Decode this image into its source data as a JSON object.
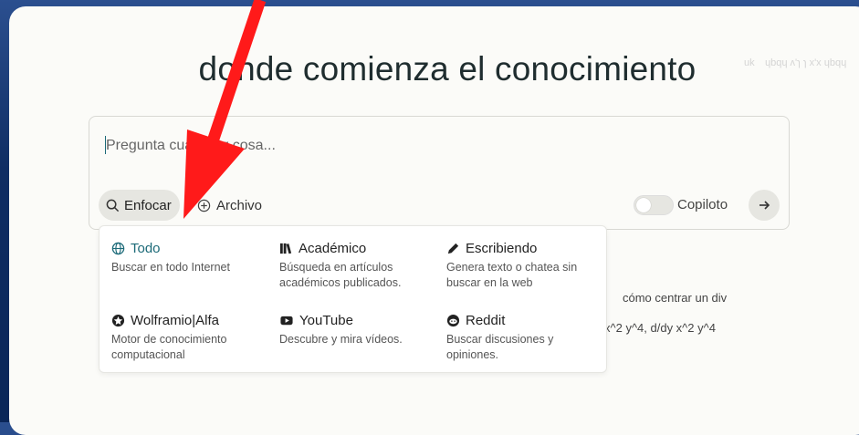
{
  "background_text": {
    "left": "uk",
    "right": "ɥbqɥ ʌ'ɿ ɿ x'x ɥbqɥ"
  },
  "headline": "donde comienza el conocimiento",
  "search": {
    "placeholder": "Pregunta cualquier cosa...",
    "value": ""
  },
  "toolbar": {
    "focus_label": "Enfocar",
    "attach_label": "Archivo",
    "copilot_label": "Copiloto",
    "copilot_on": false
  },
  "focus_menu": {
    "options": [
      {
        "icon": "globe-icon",
        "title": "Todo",
        "description": "Buscar en todo Internet",
        "active": true
      },
      {
        "icon": "books-icon",
        "title": "Académico",
        "description": "Búsqueda en artículos académicos publicados.",
        "active": false
      },
      {
        "icon": "pencil-icon",
        "title": "Escribiendo",
        "description": "Genera texto o chatea sin buscar en la web",
        "active": false
      },
      {
        "icon": "wolfram-icon",
        "title": "Wolframio|Alfa",
        "description": "Motor de conocimiento computacional",
        "active": false
      },
      {
        "icon": "youtube-icon",
        "title": "YouTube",
        "description": "Descubre y mira vídeos.",
        "active": false
      },
      {
        "icon": "reddit-icon",
        "title": "Reddit",
        "description": "Buscar discusiones y opiniones.",
        "active": false
      }
    ]
  },
  "suggestions": [
    "cómo centrar un div",
    "x^2 y^4, d/dy x^2 y^4"
  ],
  "colors": {
    "accent": "#1c6a78",
    "annotation_arrow": "#ff1a1a",
    "background": "#0f2d63",
    "card": "#fbfbf8"
  }
}
